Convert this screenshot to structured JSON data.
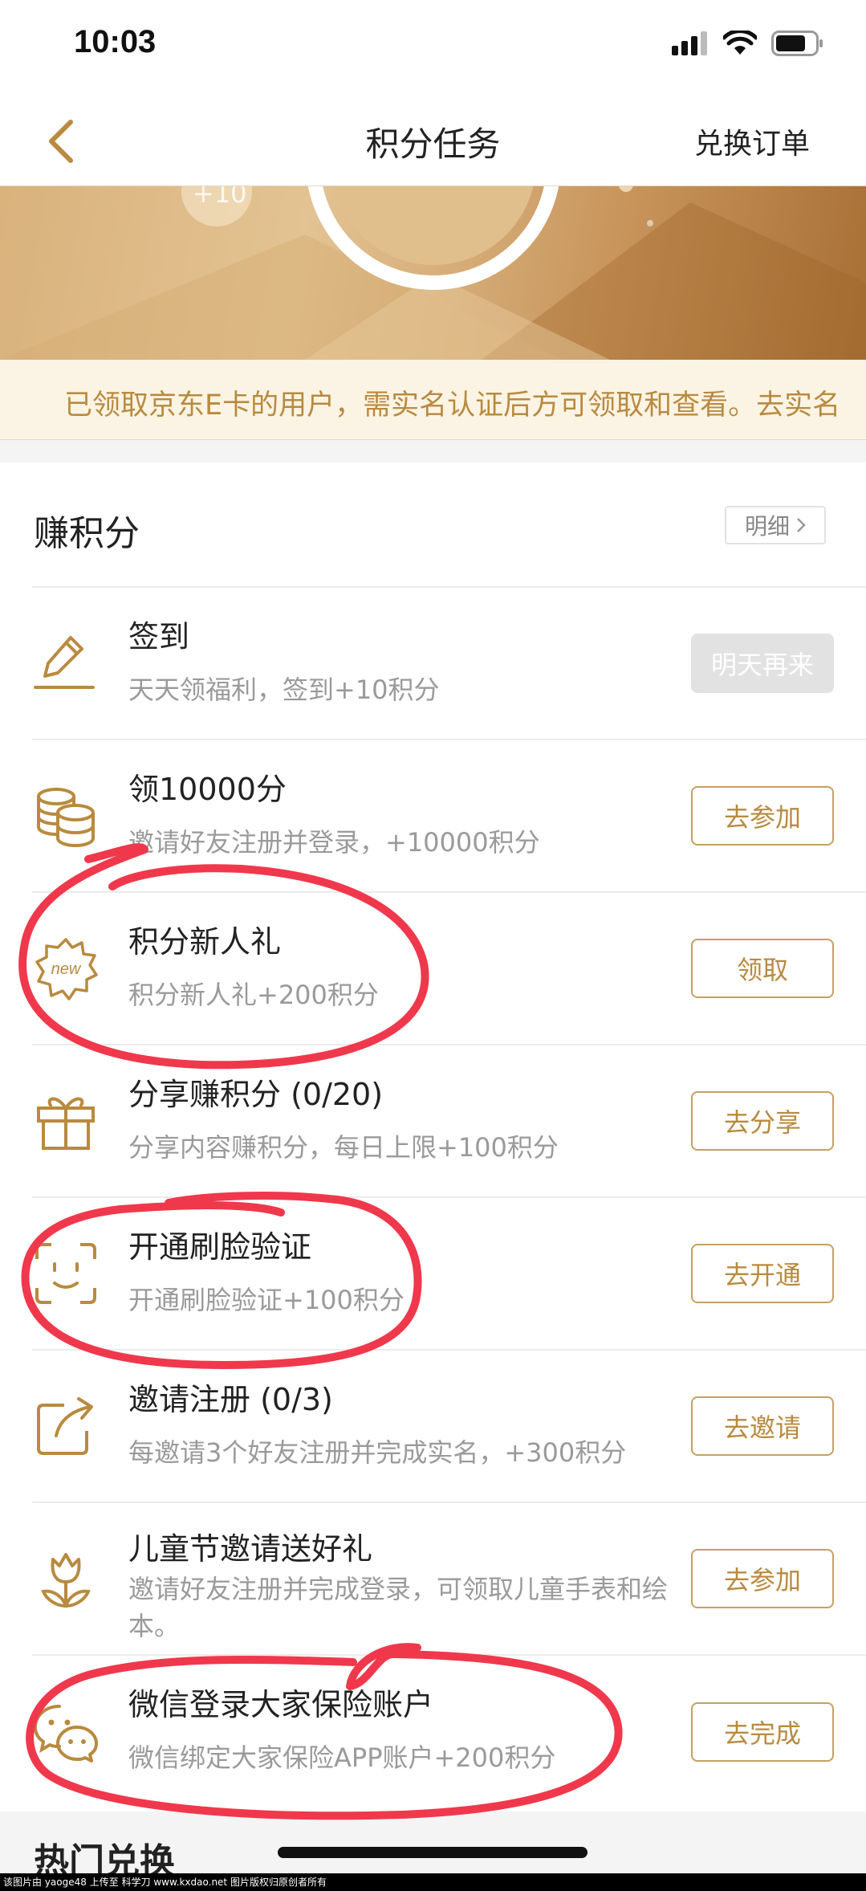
{
  "status_bar": {
    "time": "10:03"
  },
  "nav": {
    "title": "积分任务",
    "right_link": "兑换订单"
  },
  "banner": {
    "bubble_text": "+10"
  },
  "notice": {
    "text": "已领取京东E卡的用户，需实名认证后方可领取和查看。去实名"
  },
  "earn_section": {
    "title": "赚积分",
    "detail_label": "明细",
    "tasks": [
      {
        "name": "签到",
        "desc": "天天领福利，签到+10积分",
        "button": "明天再来",
        "icon": "pen-sign-icon"
      },
      {
        "name": "领10000分",
        "desc": "邀请好友注册并登录，+10000积分",
        "button": "去参加",
        "icon": "coins-stack-icon"
      },
      {
        "name": "积分新人礼",
        "desc": "积分新人礼+200积分",
        "button": "领取",
        "icon": "new-badge-icon",
        "badge_text": "new"
      },
      {
        "name": "分享赚积分 (0/20)",
        "desc": "分享内容赚积分，每日上限+100积分",
        "button": "去分享",
        "icon": "gift-icon"
      },
      {
        "name": "开通刷脸验证",
        "desc": "开通刷脸验证+100积分",
        "button": "去开通",
        "icon": "face-scan-icon"
      },
      {
        "name": "邀请注册 (0/3)",
        "desc": "每邀请3个好友注册并完成实名，+300积分",
        "button": "去邀请",
        "icon": "share-arrow-icon"
      },
      {
        "name": "儿童节邀请送好礼",
        "desc": "邀请好友注册并完成登录，可领取儿童手表和绘本。",
        "button": "去参加",
        "icon": "tulip-icon"
      },
      {
        "name": "微信登录大家保险账户",
        "desc": "微信绑定大家保险APP账户+200积分",
        "button": "去完成",
        "icon": "wechat-icon"
      }
    ]
  },
  "hot_section": {
    "title": "热门兑换"
  },
  "watermark": {
    "text": "该图片由 yaoge48 上传至 科学刀 www.kxdao.net 图片版权归原创者所有"
  },
  "colors": {
    "accent": "#b98a3f",
    "annotation": "#f0384c",
    "disabled": "#e2e2e2"
  }
}
